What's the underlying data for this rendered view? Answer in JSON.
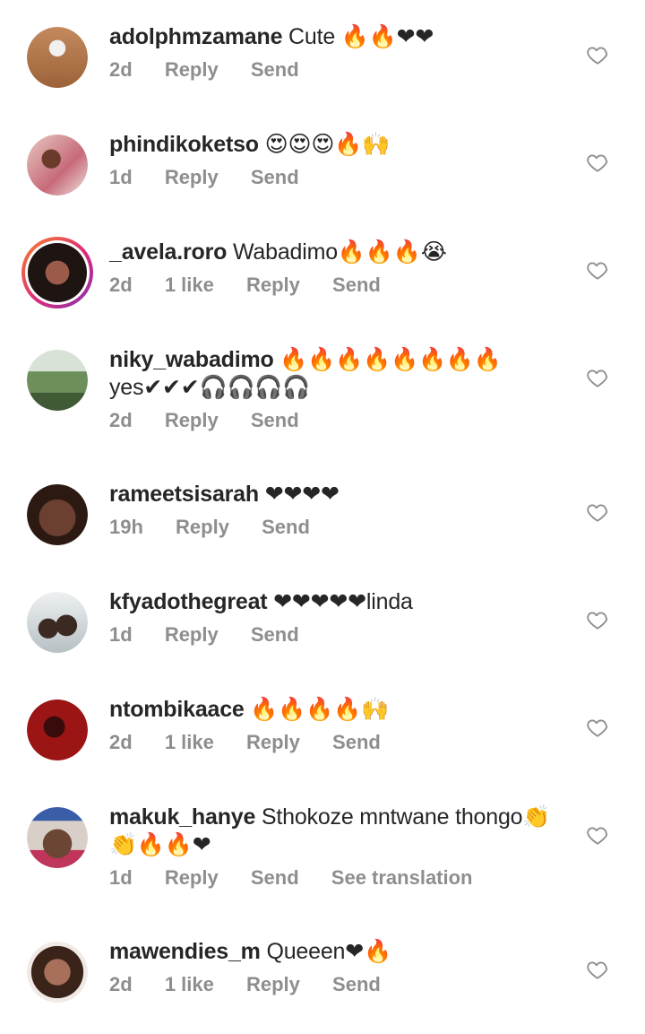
{
  "comments": [
    {
      "username": "adolphmzamane",
      "text": "Cute 🔥🔥❤❤",
      "line2": "",
      "time": "2d",
      "likes": "",
      "reply": "Reply",
      "send": "Send",
      "translate": "",
      "avatar_color": "#b7794f"
    },
    {
      "username": "phindikoketso",
      "text": "😍😍😍🔥🙌",
      "line2": "",
      "time": "1d",
      "likes": "",
      "reply": "Reply",
      "send": "Send",
      "translate": "",
      "avatar_color": "#c98a86"
    },
    {
      "username": "_avela.roro",
      "text": "Wabadimo🔥🔥🔥😭",
      "line2": "",
      "time": "2d",
      "likes": "1 like",
      "reply": "Reply",
      "send": "Send",
      "translate": "",
      "avatar_color": "#4a2a24"
    },
    {
      "username": "niky_wabadimo",
      "text": "🔥🔥🔥🔥🔥🔥🔥🔥",
      "line2": "yes✔✔✔🎧🎧🎧🎧",
      "time": "2d",
      "likes": "",
      "reply": "Reply",
      "send": "Send",
      "translate": "",
      "avatar_color": "#5e7f52"
    },
    {
      "username": "rameetsisarah",
      "text": "❤❤❤❤",
      "line2": "",
      "time": "19h",
      "likes": "",
      "reply": "Reply",
      "send": "Send",
      "translate": "",
      "avatar_color": "#5a3a28"
    },
    {
      "username": "kfyadothegreat",
      "text": "❤❤❤❤❤linda",
      "line2": "",
      "time": "1d",
      "likes": "",
      "reply": "Reply",
      "send": "Send",
      "translate": "",
      "avatar_color": "#a8b0b4"
    },
    {
      "username": "ntombikaace",
      "text": "🔥🔥🔥🔥🙌",
      "line2": "",
      "time": "2d",
      "likes": "1 like",
      "reply": "Reply",
      "send": "Send",
      "translate": "",
      "avatar_color": "#8e1414"
    },
    {
      "username": "makuk_hanye",
      "text": "Sthokoze mntwane thongo👏",
      "line2": "👏🔥🔥❤",
      "time": "1d",
      "likes": "",
      "reply": "Reply",
      "send": "Send",
      "translate": "See translation",
      "avatar_color": "#6b4a3c"
    },
    {
      "username": "mawendies_m",
      "text": "Queeen❤🔥",
      "line2": "",
      "time": "2d",
      "likes": "1 like",
      "reply": "Reply",
      "send": "Send",
      "translate": "",
      "avatar_color": "#7a4a38"
    }
  ]
}
